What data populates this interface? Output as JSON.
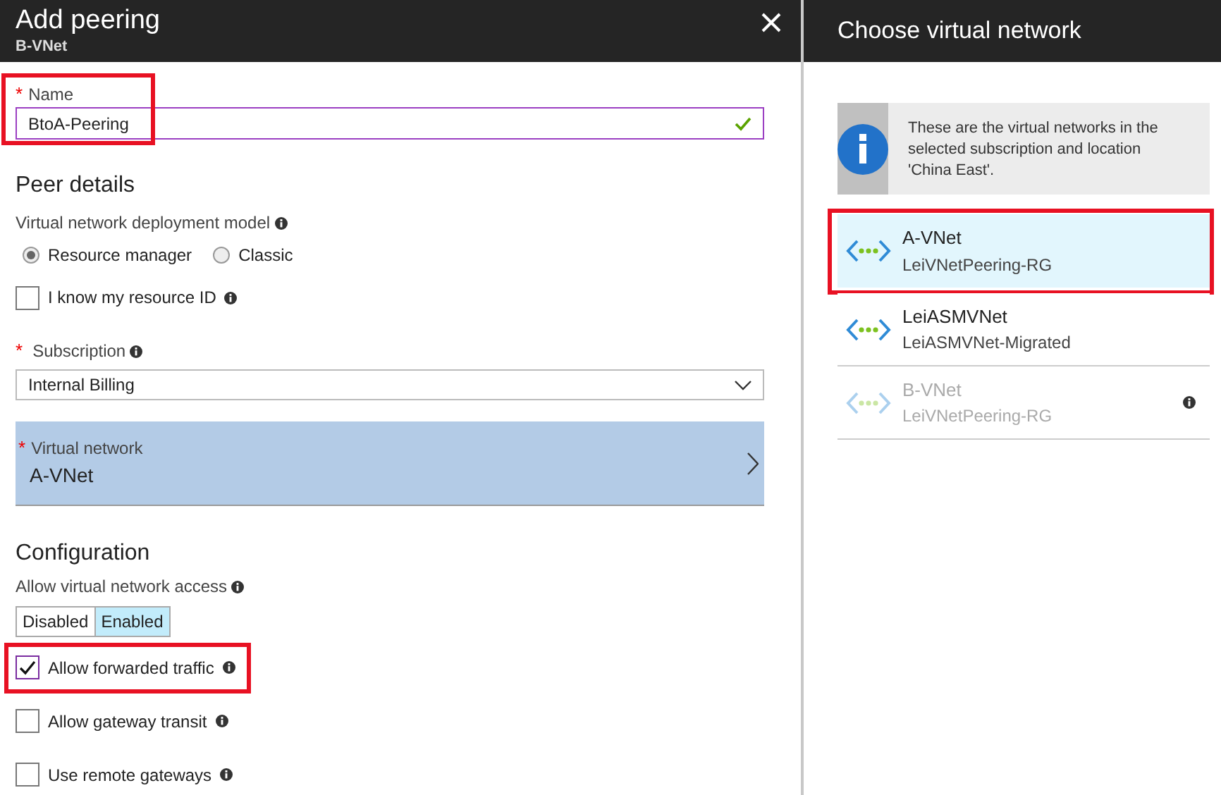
{
  "add_peering": {
    "title": "Add peering",
    "subtitle": "B-VNet",
    "name": {
      "label": "Name",
      "required_mark": "*",
      "value": "BtoA-Peering",
      "valid": true,
      "highlighted": true
    },
    "peer_details": {
      "heading": "Peer details",
      "deployment_model": {
        "label": "Virtual network deployment model",
        "options": [
          {
            "label": "Resource manager",
            "selected": true
          },
          {
            "label": "Classic",
            "selected": false
          }
        ]
      },
      "know_resource_id": {
        "label": "I know my resource ID",
        "checked": false
      },
      "subscription": {
        "label": "Subscription",
        "required_mark": "*",
        "value": "Internal Billing"
      },
      "virtual_network": {
        "label": "Virtual network",
        "required_mark": "*",
        "value": "A-VNet"
      }
    },
    "configuration": {
      "heading": "Configuration",
      "access": {
        "label": "Allow virtual network access",
        "options": [
          {
            "label": "Disabled",
            "selected": false
          },
          {
            "label": "Enabled",
            "selected": true
          }
        ]
      },
      "checkboxes": [
        {
          "label": "Allow forwarded traffic",
          "checked": true,
          "highlighted": true
        },
        {
          "label": "Allow gateway transit",
          "checked": false,
          "highlighted": false
        },
        {
          "label": "Use remote gateways",
          "checked": false,
          "highlighted": false
        }
      ]
    }
  },
  "choose_network": {
    "title": "Choose virtual network",
    "info": "These are the virtual networks in the selected subscription and location 'China East'.",
    "networks": [
      {
        "name": "A-VNet",
        "group": "LeiVNetPeering-RG",
        "selected": true,
        "disabled": false,
        "highlighted": true
      },
      {
        "name": "LeiASMVNet",
        "group": "LeiASMVNet-Migrated",
        "selected": false,
        "disabled": false,
        "highlighted": false
      },
      {
        "name": "B-VNet",
        "group": "LeiVNetPeering-RG",
        "selected": false,
        "disabled": true,
        "highlighted": false
      }
    ]
  }
}
